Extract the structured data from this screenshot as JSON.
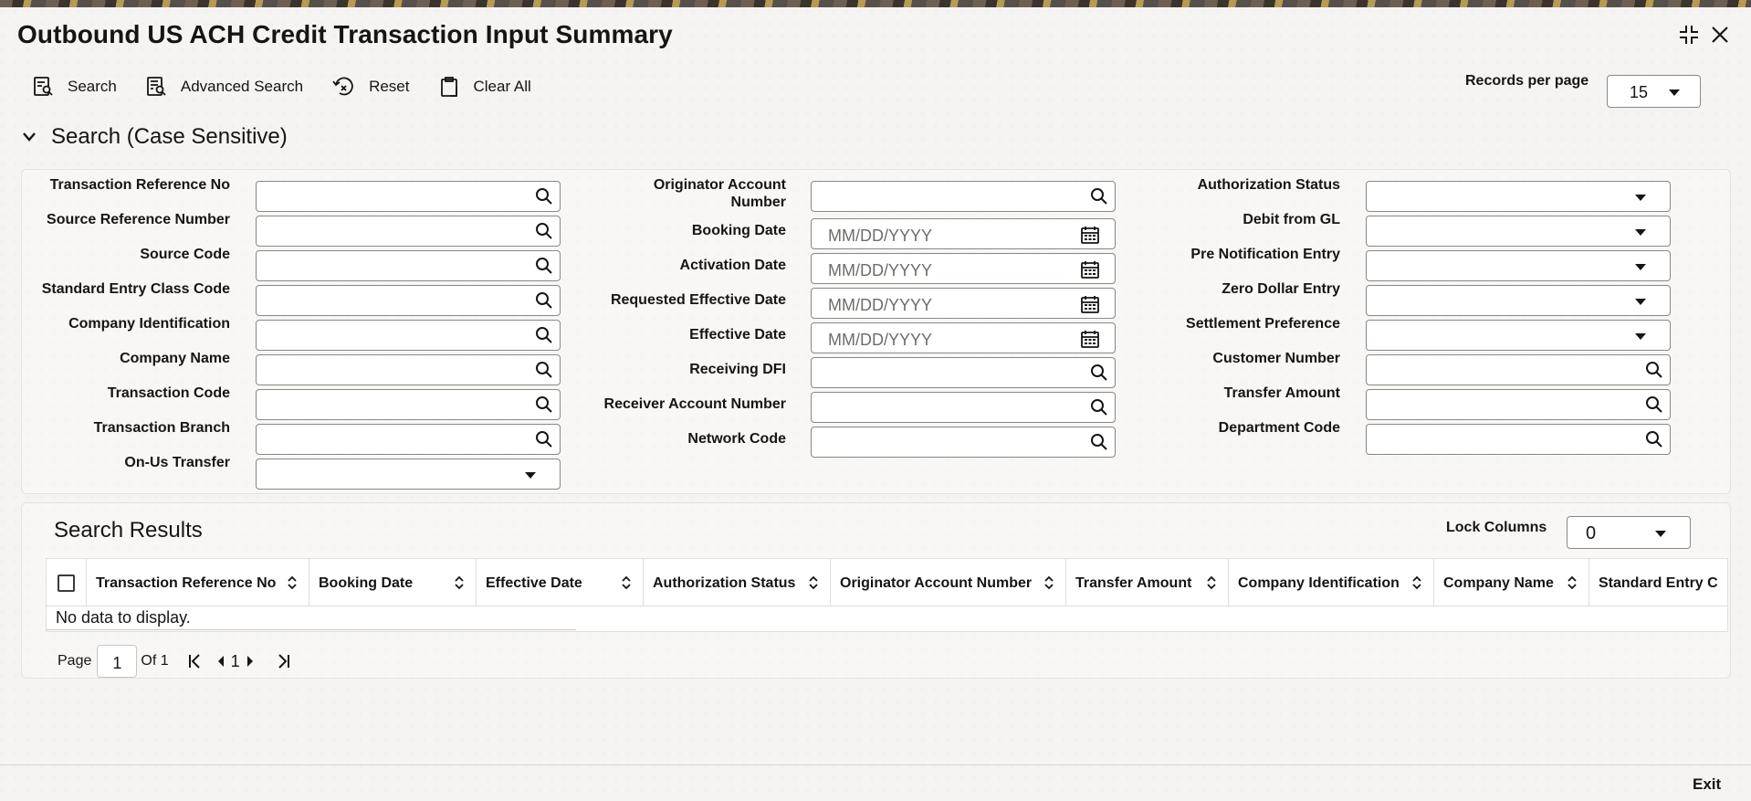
{
  "title": "Outbound US ACH Credit Transaction Input Summary",
  "toolbar": {
    "search": "Search",
    "advanced_search": "Advanced Search",
    "reset": "Reset",
    "clear_all": "Clear All"
  },
  "records_per_page": {
    "label": "Records per page",
    "value": "15"
  },
  "search_section": {
    "title": "Search (Case Sensitive)"
  },
  "fields": {
    "transaction_reference_no": "Transaction Reference No",
    "source_reference_number": "Source Reference Number",
    "source_code": "Source Code",
    "standard_entry_class_code": "Standard Entry Class Code",
    "company_identification": "Company Identification",
    "company_name": "Company Name",
    "transaction_code": "Transaction Code",
    "transaction_branch": "Transaction Branch",
    "on_us_transfer": "On-Us Transfer",
    "originator_account_number_1": "Originator Account",
    "originator_account_number_2": "Number",
    "booking_date": "Booking Date",
    "activation_date": "Activation Date",
    "requested_effective_date": "Requested Effective Date",
    "effective_date": "Effective Date",
    "receiving_dfi": "Receiving DFI",
    "receiver_account_number": "Receiver Account Number",
    "network_code": "Network Code",
    "authorization_status": "Authorization Status",
    "debit_from_gl": "Debit from GL",
    "pre_notification_entry": "Pre Notification Entry",
    "zero_dollar_entry": "Zero Dollar Entry",
    "settlement_preference": "Settlement Preference",
    "customer_number": "Customer Number",
    "transfer_amount": "Transfer Amount",
    "department_code": "Department Code",
    "date_placeholder": "MM/DD/YYYY"
  },
  "results": {
    "title": "Search Results",
    "lock_columns_label": "Lock Columns",
    "lock_columns_value": "0",
    "columns": [
      "Transaction Reference No",
      "Booking Date",
      "Effective Date",
      "Authorization Status",
      "Originator Account Number",
      "Transfer Amount",
      "Company Identification",
      "Company Name",
      "Standard Entry C"
    ],
    "no_data": "No data to display."
  },
  "pager": {
    "page_label": "Page",
    "page_value": "1",
    "of_label": "Of 1",
    "current": "1"
  },
  "footer": {
    "exit": "Exit"
  },
  "icons": {
    "maximize": "collapse-corners-icon",
    "close": "close-icon",
    "search": "magnifier-icon",
    "calendar": "calendar-icon",
    "sort": "sort-updown-icon"
  }
}
